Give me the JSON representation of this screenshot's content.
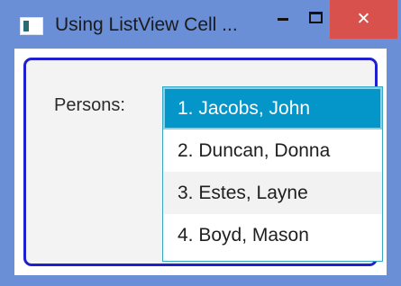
{
  "window": {
    "title": "Using ListView Cell ...",
    "close_glyph": "✕",
    "icons": {
      "app": "app-icon",
      "minimize": "minimize-icon",
      "maximize": "maximize-icon",
      "close": "close-icon"
    }
  },
  "form": {
    "label": "Persons:"
  },
  "list": {
    "items": [
      {
        "label": "1. Jacobs, John",
        "selected": true
      },
      {
        "label": "2. Duncan, Donna",
        "selected": false
      },
      {
        "label": "3. Estes, Layne",
        "selected": false
      },
      {
        "label": "4. Boyd, Mason",
        "selected": false
      }
    ]
  },
  "colors": {
    "titlebar": "#6b8fd6",
    "close_button": "#d9514c",
    "selection": "#0596c9",
    "focus_border": "#1f1fd0",
    "list_border": "#38a8c5"
  }
}
